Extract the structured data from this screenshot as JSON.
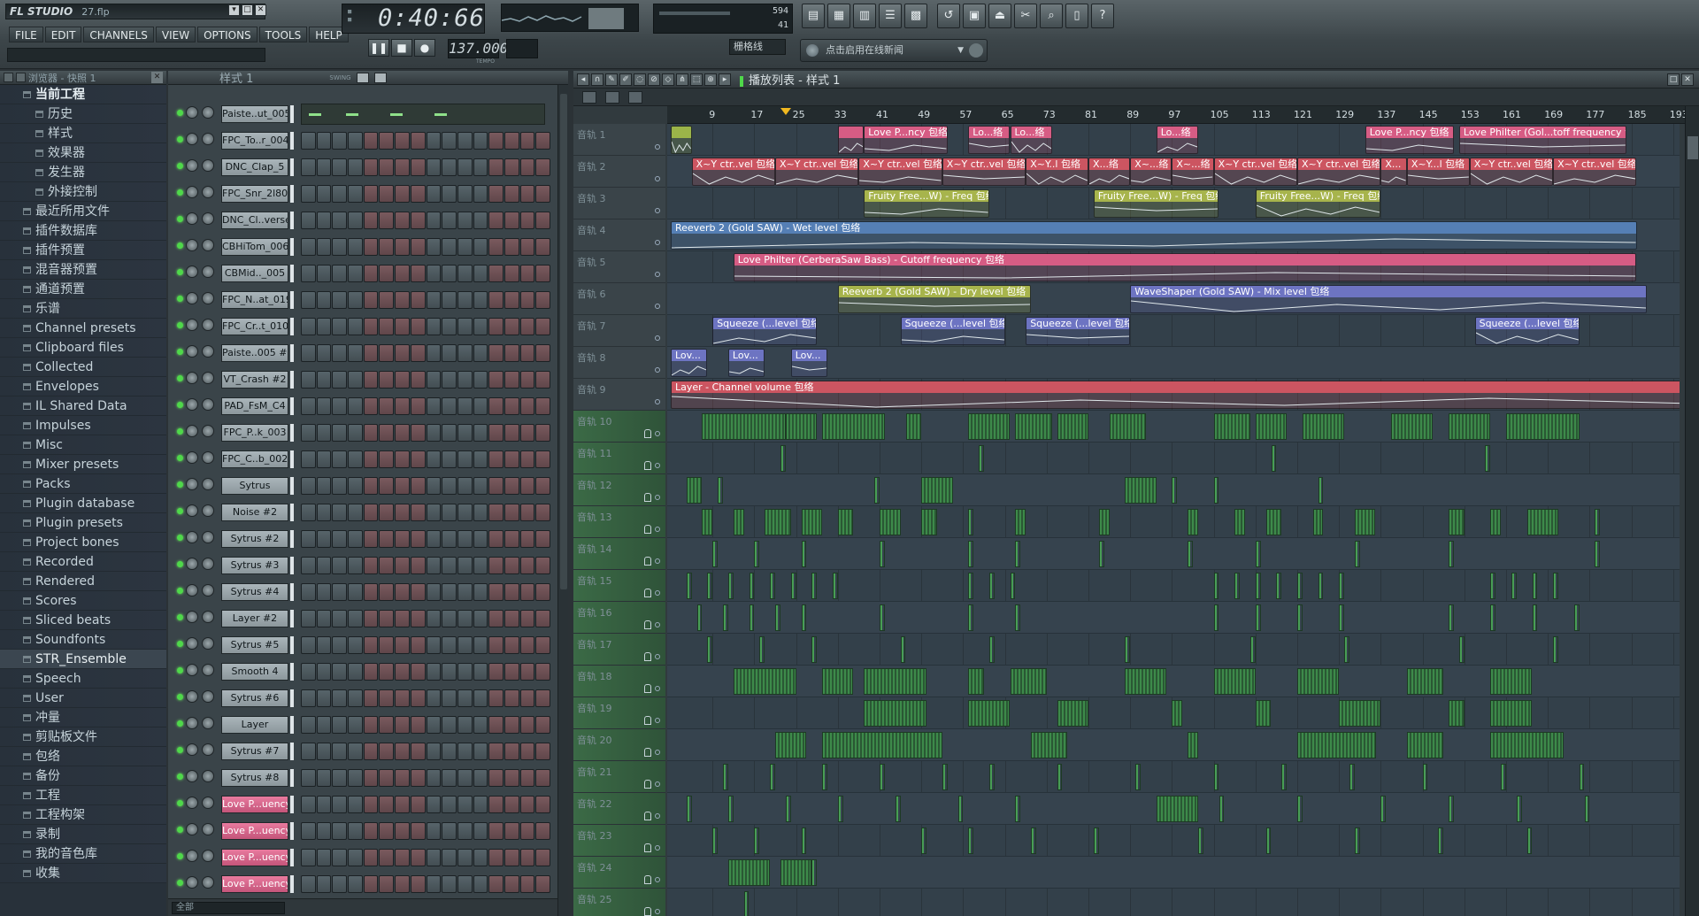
{
  "window": {
    "app_logo": "FL STUDIO",
    "file_name": "27.flp"
  },
  "menu": [
    "FILE",
    "EDIT",
    "CHANNELS",
    "VIEW",
    "OPTIONS",
    "TOOLS",
    "HELP"
  ],
  "transport": {
    "time": "0:40:66",
    "tempo": "137.000",
    "tempo_label": "TEMPO",
    "cpu": "594",
    "poly": "41",
    "snap": "栅格线",
    "news": "点击启用在线新闻"
  },
  "browser": {
    "title": "浏览器 - 快照 1",
    "items": [
      {
        "label": "当前工程",
        "level": "top"
      },
      {
        "label": "历史",
        "level": "sub"
      },
      {
        "label": "样式",
        "level": "sub"
      },
      {
        "label": "效果器",
        "level": "sub"
      },
      {
        "label": "发生器",
        "level": "sub"
      },
      {
        "label": "外接控制",
        "level": "sub"
      },
      {
        "label": "最近所用文件"
      },
      {
        "label": "插件数据库"
      },
      {
        "label": "插件预置"
      },
      {
        "label": "混音器预置"
      },
      {
        "label": "通道预置"
      },
      {
        "label": "乐谱"
      },
      {
        "label": "Channel presets"
      },
      {
        "label": "Clipboard files"
      },
      {
        "label": "Collected"
      },
      {
        "label": "Envelopes"
      },
      {
        "label": "IL Shared Data"
      },
      {
        "label": "Impulses"
      },
      {
        "label": "Misc"
      },
      {
        "label": "Mixer presets"
      },
      {
        "label": "Packs"
      },
      {
        "label": "Plugin database"
      },
      {
        "label": "Plugin presets"
      },
      {
        "label": "Project bones"
      },
      {
        "label": "Recorded"
      },
      {
        "label": "Rendered"
      },
      {
        "label": "Scores"
      },
      {
        "label": "Sliced beats"
      },
      {
        "label": "Soundfonts"
      },
      {
        "label": "STR_Ensemble",
        "level": "hl"
      },
      {
        "label": "Speech"
      },
      {
        "label": "User"
      },
      {
        "label": "冲量"
      },
      {
        "label": "剪贴板文件"
      },
      {
        "label": "包络"
      },
      {
        "label": "备份"
      },
      {
        "label": "工程"
      },
      {
        "label": "工程构架"
      },
      {
        "label": "录制"
      },
      {
        "label": "我的音色库"
      },
      {
        "label": "收集"
      }
    ]
  },
  "rack": {
    "title": "样式 1",
    "swing_label": "SWING",
    "filter": "全部",
    "channels": [
      {
        "name": "Paiste..ut_005",
        "mode": "roll"
      },
      {
        "name": "FPC_To..r_004"
      },
      {
        "name": "DNC_Clap_5"
      },
      {
        "name": "FPC_Snr_2l803"
      },
      {
        "name": "DNC_Cl..verse"
      },
      {
        "name": "CBHiTom_006"
      },
      {
        "name": "CBMid.._005"
      },
      {
        "name": "FPC_N..at_019"
      },
      {
        "name": "FPC_Cr..t_010"
      },
      {
        "name": "Paiste..005 #2"
      },
      {
        "name": "VT_Crash #2"
      },
      {
        "name": "PAD_FsM_C4"
      },
      {
        "name": "FPC_P..k_003"
      },
      {
        "name": "FPC_C..b_002"
      },
      {
        "name": "Sytrus"
      },
      {
        "name": "Noise #2"
      },
      {
        "name": "Sytrus #2"
      },
      {
        "name": "Sytrus #3"
      },
      {
        "name": "Sytrus #4"
      },
      {
        "name": "Layer #2"
      },
      {
        "name": "Sytrus #5"
      },
      {
        "name": "Smooth 4"
      },
      {
        "name": "Sytrus #6"
      },
      {
        "name": "Layer"
      },
      {
        "name": "Sytrus #7"
      },
      {
        "name": "Sytrus #8"
      },
      {
        "name": "Love P...uency",
        "color": "pink"
      },
      {
        "name": "Love P...uency",
        "color": "pink"
      },
      {
        "name": "Love P...uency",
        "color": "pink"
      },
      {
        "name": "Love P...uency",
        "color": "pink"
      }
    ]
  },
  "playlist": {
    "title": "播放列表 - 样式 1",
    "bars": [
      9,
      17,
      25,
      33,
      41,
      49,
      57,
      65,
      73,
      81,
      89,
      97,
      105,
      113,
      121,
      129,
      137,
      145,
      153,
      161,
      169,
      177,
      185,
      193
    ],
    "playhead_bar": 23,
    "tracks": [
      "音轨 1",
      "音轨 2",
      "音轨 3",
      "音轨 4",
      "音轨 5",
      "音轨 6",
      "音轨 7",
      "音轨 8",
      "音轨 9",
      "音轨 10",
      "音轨 11",
      "音轨 12",
      "音轨 13",
      "音轨 14",
      "音轨 15",
      "音轨 16",
      "音轨 17",
      "音轨 18",
      "音轨 19",
      "音轨 20",
      "音轨 21",
      "音轨 22",
      "音轨 23",
      "音轨 24",
      "音轨 25"
    ],
    "automation_clips": [
      {
        "track": 0,
        "start": 1,
        "len": 4,
        "label": "",
        "color": "lime"
      },
      {
        "track": 0,
        "start": 33,
        "len": 5,
        "label": "",
        "color": "pink"
      },
      {
        "track": 0,
        "start": 38,
        "len": 16,
        "label": "Love P...ncy 包络",
        "color": "pink"
      },
      {
        "track": 0,
        "start": 58,
        "len": 8,
        "label": "Lo...络",
        "color": "pink"
      },
      {
        "track": 0,
        "start": 66,
        "len": 8,
        "label": "Lo...络",
        "color": "pink"
      },
      {
        "track": 0,
        "start": 94,
        "len": 8,
        "label": "Lo...络",
        "color": "pink"
      },
      {
        "track": 0,
        "start": 134,
        "len": 17,
        "label": "Love P...ncy 包络",
        "color": "pink"
      },
      {
        "track": 0,
        "start": 152,
        "len": 32,
        "label": "Love Philter (Gol...toff frequency 包络",
        "color": "pink"
      },
      {
        "track": 1,
        "start": 5,
        "len": 16,
        "label": "X~Y ctr..vel 包络",
        "color": "red"
      },
      {
        "track": 1,
        "start": 21,
        "len": 16,
        "label": "X~Y ctr..vel 包络",
        "color": "red"
      },
      {
        "track": 1,
        "start": 37,
        "len": 16,
        "label": "X~Y ctr..vel 包络",
        "color": "red"
      },
      {
        "track": 1,
        "start": 53,
        "len": 16,
        "label": "X~Y ctr..vel 包络",
        "color": "red"
      },
      {
        "track": 1,
        "start": 69,
        "len": 12,
        "label": "X~Y..l 包络",
        "color": "red"
      },
      {
        "track": 1,
        "start": 81,
        "len": 8,
        "label": "X...络",
        "color": "red"
      },
      {
        "track": 1,
        "start": 89,
        "len": 8,
        "label": "X~...络",
        "color": "red"
      },
      {
        "track": 1,
        "start": 97,
        "len": 8,
        "label": "X~...络",
        "color": "red"
      },
      {
        "track": 1,
        "start": 105,
        "len": 16,
        "label": "X~Y ctr..vel 包络",
        "color": "red"
      },
      {
        "track": 1,
        "start": 121,
        "len": 16,
        "label": "X~Y ctr..vel 包络",
        "color": "red"
      },
      {
        "track": 1,
        "start": 137,
        "len": 5,
        "label": "X...",
        "color": "red"
      },
      {
        "track": 1,
        "start": 142,
        "len": 12,
        "label": "X~Y...l 包络",
        "color": "red"
      },
      {
        "track": 1,
        "start": 154,
        "len": 16,
        "label": "X~Y ctr..vel 包络",
        "color": "red"
      },
      {
        "track": 1,
        "start": 170,
        "len": 16,
        "label": "X~Y ctr..vel 包络",
        "color": "red"
      },
      {
        "track": 2,
        "start": 38,
        "len": 24,
        "label": "Fruity Free...W) - Freq 包络",
        "color": "yel"
      },
      {
        "track": 2,
        "start": 82,
        "len": 24,
        "label": "Fruity Free...W) - Freq 包络",
        "color": "yel"
      },
      {
        "track": 2,
        "start": 113,
        "len": 24,
        "label": "Fruity Free...W) - Freq 包络",
        "color": "yel"
      },
      {
        "track": 3,
        "start": 1,
        "len": 185,
        "label": "Reeverb 2 (Gold SAW) - Wet level 包络",
        "color": "blue"
      },
      {
        "track": 4,
        "start": 13,
        "len": 173,
        "label": "Love Philter (CerberaSaw Bass) - Cutoff frequency 包络",
        "color": "pink"
      },
      {
        "track": 5,
        "start": 33,
        "len": 37,
        "label": "Reeverb 2 (Gold SAW) - Dry level 包络",
        "color": "yel"
      },
      {
        "track": 5,
        "start": 89,
        "len": 99,
        "label": "WaveShaper (Gold SAW) - Mix level 包络",
        "color": "vio"
      },
      {
        "track": 6,
        "start": 9,
        "len": 20,
        "label": "Squeeze (...level 包络",
        "color": "vio"
      },
      {
        "track": 6,
        "start": 45,
        "len": 20,
        "label": "Squeeze (...level 包络",
        "color": "vio"
      },
      {
        "track": 6,
        "start": 69,
        "len": 20,
        "label": "Squeeze (...level 包络",
        "color": "vio"
      },
      {
        "track": 6,
        "start": 155,
        "len": 20,
        "label": "Squeeze (...level 包络",
        "color": "vio"
      },
      {
        "track": 7,
        "start": 1,
        "len": 7,
        "label": "Lov...",
        "color": "vio"
      },
      {
        "track": 7,
        "start": 12,
        "len": 7,
        "label": "Lov...",
        "color": "vio"
      },
      {
        "track": 7,
        "start": 24,
        "len": 7,
        "label": "Lov...",
        "color": "vio"
      },
      {
        "track": 8,
        "start": 1,
        "len": 196,
        "label": "Layer - Channel volume 包络",
        "color": "red"
      }
    ]
  }
}
